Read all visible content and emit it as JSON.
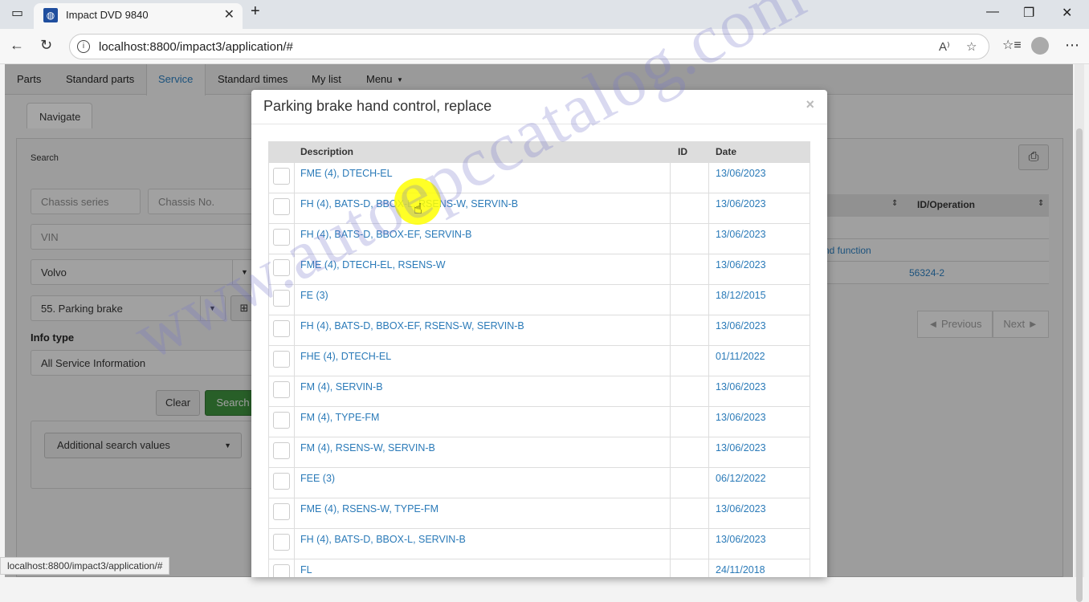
{
  "browser": {
    "tab_title": "Impact DVD 9840",
    "url": "localhost:8800/impact3/application/#",
    "status_url": "localhost:8800/impact3/application/#"
  },
  "topnav": {
    "items": [
      "Parts",
      "Standard parts",
      "Service",
      "Standard times",
      "My list",
      "Menu"
    ],
    "active": "Service"
  },
  "subtab": {
    "label": "Navigate"
  },
  "search": {
    "label": "Search",
    "chassis_series_placeholder": "Chassis series",
    "chassis_no_placeholder": "Chassis No.",
    "vin_placeholder": "VIN",
    "brand_value": "Volvo",
    "function_group_value": "55. Parking brake",
    "info_type_label": "Info type",
    "info_type_value": "All Service Information",
    "clear_label": "Clear",
    "search_label": "Search",
    "additional_label": "Additional search values"
  },
  "results": {
    "col_id_operation": "ID/Operation",
    "row_text_partial": "nd function",
    "row_id": "56324-2",
    "previous_label": "Previous",
    "next_label": "Next"
  },
  "modal": {
    "title": "Parking brake hand control, replace",
    "close_label": "×",
    "columns": {
      "description": "Description",
      "id": "ID",
      "date": "Date"
    },
    "rows": [
      {
        "description": "FME (4), DTECH-EL",
        "id": "",
        "date": "13/06/2023"
      },
      {
        "description": "FH (4), BATS-D, BBOX-L, RSENS-W, SERVIN-B",
        "id": "",
        "date": "13/06/2023"
      },
      {
        "description": "FH (4), BATS-D, BBOX-EF, SERVIN-B",
        "id": "",
        "date": "13/06/2023"
      },
      {
        "description": "FME (4), DTECH-EL, RSENS-W",
        "id": "",
        "date": "13/06/2023"
      },
      {
        "description": "FE (3)",
        "id": "",
        "date": "18/12/2015"
      },
      {
        "description": "FH (4), BATS-D, BBOX-EF, RSENS-W, SERVIN-B",
        "id": "",
        "date": "13/06/2023"
      },
      {
        "description": "FHE (4), DTECH-EL",
        "id": "",
        "date": "01/11/2022"
      },
      {
        "description": "FM (4), SERVIN-B",
        "id": "",
        "date": "13/06/2023"
      },
      {
        "description": "FM (4), TYPE-FM",
        "id": "",
        "date": "13/06/2023"
      },
      {
        "description": "FM (4), RSENS-W, SERVIN-B",
        "id": "",
        "date": "13/06/2023"
      },
      {
        "description": "FEE (3)",
        "id": "",
        "date": "06/12/2022"
      },
      {
        "description": "FME (4), RSENS-W, TYPE-FM",
        "id": "",
        "date": "13/06/2023"
      },
      {
        "description": "FH (4), BATS-D, BBOX-L, SERVIN-B",
        "id": "",
        "date": "13/06/2023"
      },
      {
        "description": "FL",
        "id": "",
        "date": "24/11/2018"
      }
    ]
  },
  "watermark": "www.autoepccatalog.com",
  "colors": {
    "link": "#2a7ab8",
    "search_button": "#3c8c3c",
    "highlight": "#ffff00"
  }
}
